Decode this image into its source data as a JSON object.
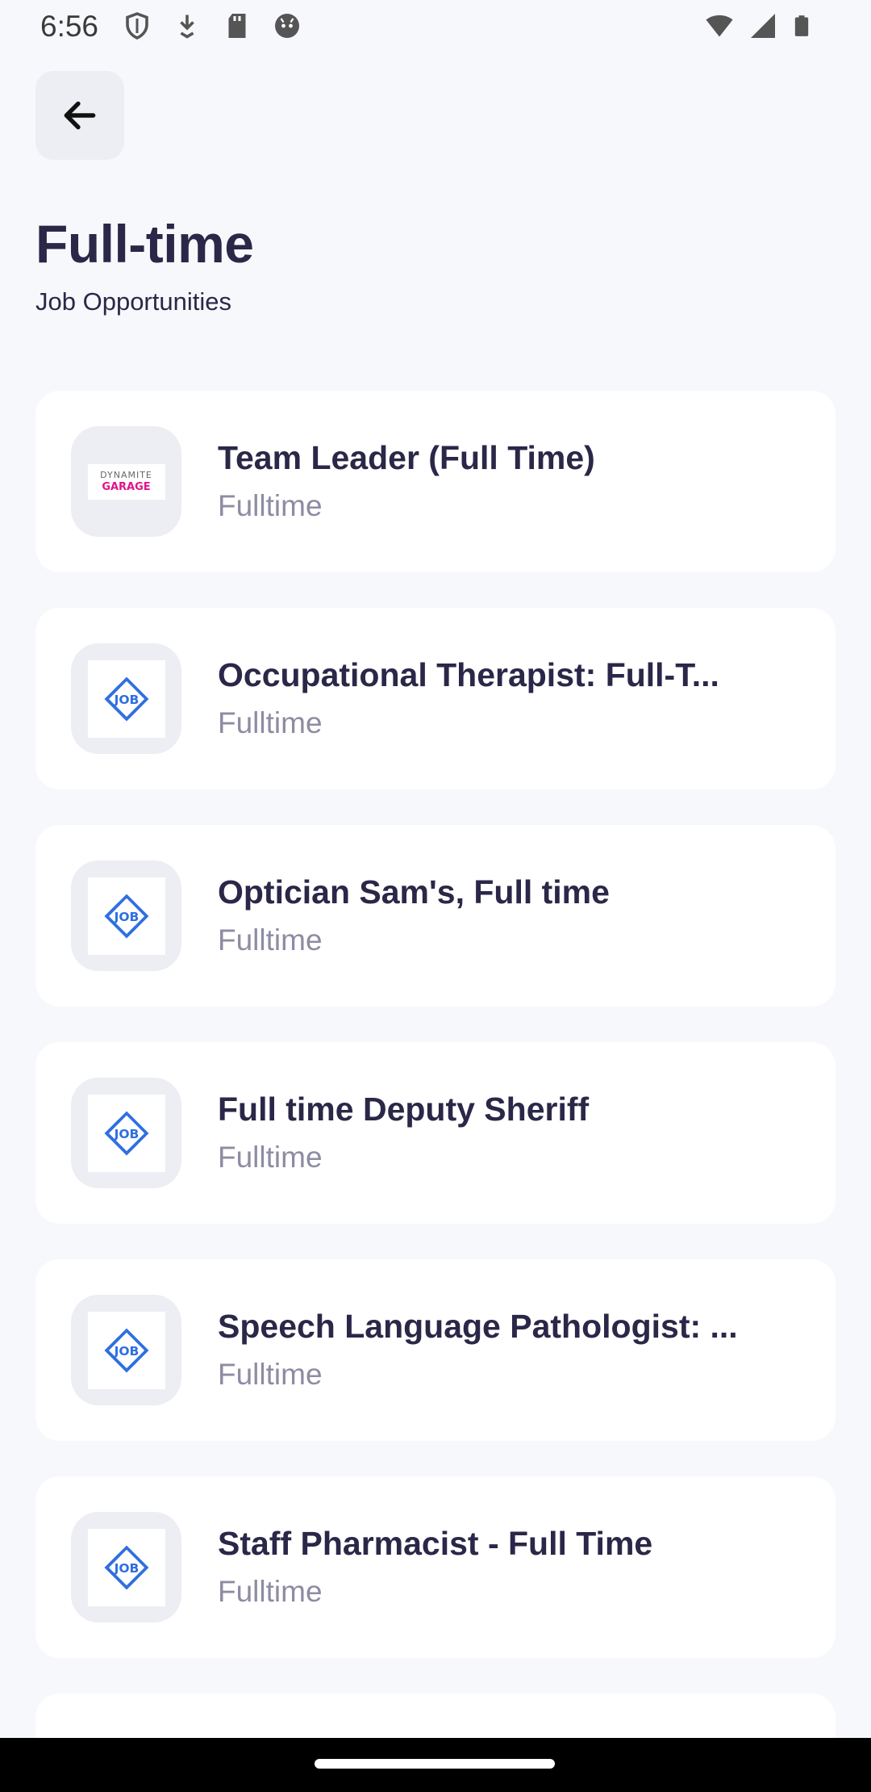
{
  "status_bar": {
    "time": "6:56",
    "left_icons": [
      "shield-icon",
      "download-icon",
      "sd-card-icon",
      "android-icon"
    ],
    "right_icons": [
      "wifi-icon",
      "signal-icon",
      "battery-icon"
    ]
  },
  "header": {
    "back_icon": "arrow-left-icon",
    "title": "Full-time",
    "subtitle": "Job Opportunities"
  },
  "jobs": [
    {
      "title": "Team Leader (Full Time)",
      "type": "Fulltime",
      "logo": "dynamite-garage",
      "logo_text": [
        "DYNAMITE",
        "GARAGE"
      ]
    },
    {
      "title": "Occupational Therapist: Full-T...",
      "type": "Fulltime",
      "logo": "job-icon"
    },
    {
      "title": "Optician Sam's, Full time",
      "type": "Fulltime",
      "logo": "job-icon"
    },
    {
      "title": "Full time Deputy Sheriff",
      "type": "Fulltime",
      "logo": "job-icon"
    },
    {
      "title": "Speech Language Pathologist: ...",
      "type": "Fulltime",
      "logo": "job-icon"
    },
    {
      "title": "Staff Pharmacist - Full Time",
      "type": "Fulltime",
      "logo": "job-icon"
    }
  ],
  "colors": {
    "background": "#f7f8fb",
    "card": "#ffffff",
    "title": "#2a2748",
    "subtext": "#8d8ca3",
    "logo_blue": "#2f6fe0",
    "logo_pink": "#e0148a"
  }
}
